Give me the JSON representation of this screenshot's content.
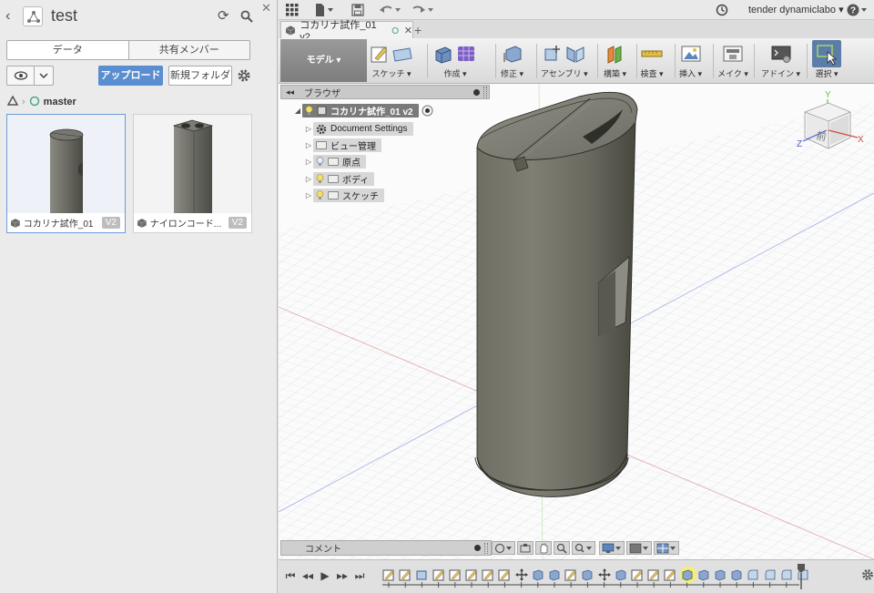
{
  "data_panel": {
    "project_title": "test",
    "tabs": [
      {
        "label": "データ",
        "active": true
      },
      {
        "label": "共有メンバー",
        "active": false
      }
    ],
    "upload_label": "アップロード",
    "new_folder_label": "新規フォルダ",
    "branch": "master",
    "files": [
      {
        "name": "コカリナ試作_01",
        "version": "V2",
        "selected": true
      },
      {
        "name": "ナイロンコード...",
        "version": "V2",
        "selected": false
      }
    ]
  },
  "appbar": {
    "user_name": "tender dynamiclabo"
  },
  "document": {
    "tab_title": "コカリナ試作_01 v2"
  },
  "ribbon": {
    "workspace": "モデル",
    "groups": [
      {
        "label": "スケッチ"
      },
      {
        "label": "作成"
      },
      {
        "label": "修正"
      },
      {
        "label": "アセンブリ"
      },
      {
        "label": "構築"
      },
      {
        "label": "検査"
      },
      {
        "label": "挿入"
      },
      {
        "label": "メイク"
      },
      {
        "label": "アドイン"
      },
      {
        "label": "選択"
      }
    ],
    "colors": {
      "active": "#5c7da8",
      "accent": "#5b8ed0"
    }
  },
  "browser": {
    "title": "ブラウザ",
    "root": "コカリナ試作_01 v2",
    "items": [
      {
        "label": "Document Settings"
      },
      {
        "label": "ビュー管理"
      },
      {
        "label": "原点"
      },
      {
        "label": "ボディ"
      },
      {
        "label": "スケッチ"
      }
    ]
  },
  "viewcube": {
    "face_label": "前",
    "axis_x": "X",
    "axis_y": "Y",
    "axis_z": "Z"
  },
  "comments": {
    "label": "コメント"
  }
}
